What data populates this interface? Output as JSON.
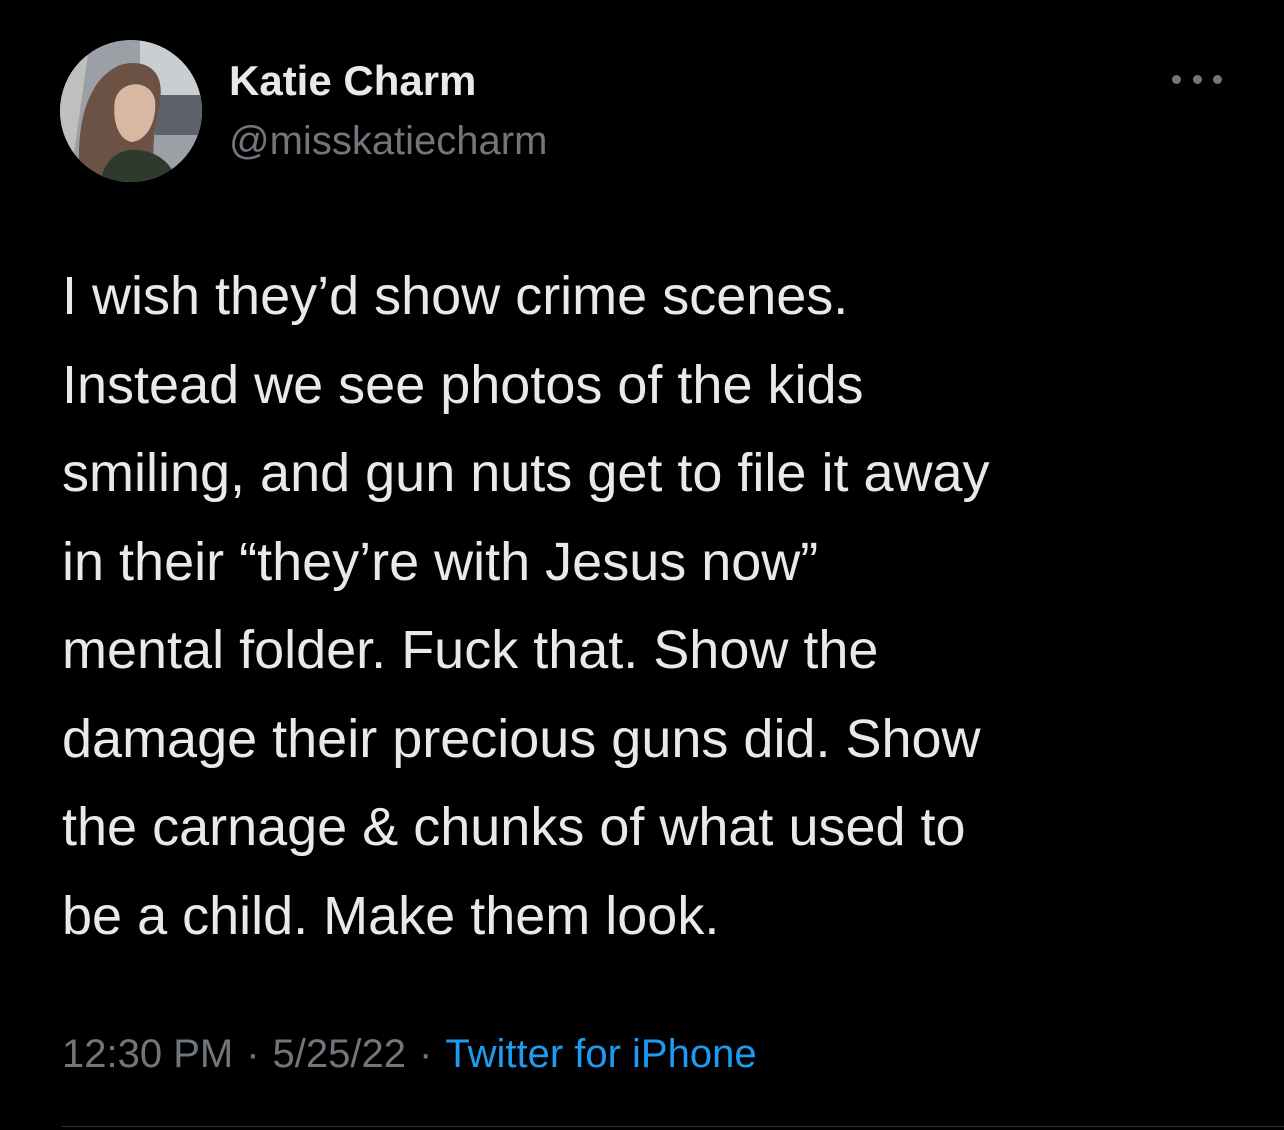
{
  "tweet": {
    "author": {
      "display_name": "Katie Charm",
      "handle": "@misskatiecharm",
      "avatar_icon": "profile-photo"
    },
    "more_icon": "more-options-icon",
    "text_lines": [
      "I wish they’d show crime scenes.",
      "Instead we see photos of the kids",
      "smiling, and gun nuts get to file it away",
      "in their “they’re with Jesus now”",
      "mental folder. Fuck that. Show the",
      "damage their precious guns did. Show",
      "the carnage & chunks of what used to",
      "be a child. Make them look."
    ],
    "time": "12:30 PM",
    "date": "5/25/22",
    "separator": "·",
    "source": "Twitter for iPhone"
  },
  "colors": {
    "background": "#000000",
    "text_primary": "#e7e9ea",
    "text_secondary": "#71767b",
    "link": "#1d9bf0",
    "divider": "#2f3336"
  }
}
